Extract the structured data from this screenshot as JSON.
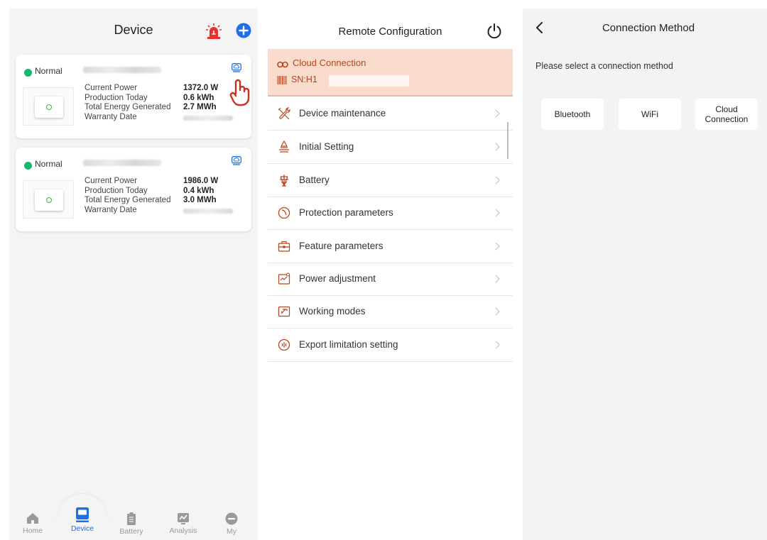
{
  "device_screen": {
    "title": "Device",
    "cards": [
      {
        "status": "Normal",
        "labels": [
          "Current Power",
          "Production Today",
          "Total Energy Generated",
          "Warranty Date"
        ],
        "current_power": "1372.0 W",
        "production_today": "0.6 kWh",
        "total_energy": "2.7 MWh"
      },
      {
        "status": "Normal",
        "labels": [
          "Current Power",
          "Production Today",
          "Total Energy Generated",
          "Warranty Date"
        ],
        "current_power": "1986.0 W",
        "production_today": "0.4 kWh",
        "total_energy": "3.0 MWh"
      }
    ],
    "tabs": [
      {
        "label": "Home",
        "icon": "home-icon"
      },
      {
        "label": "Device",
        "icon": "device-icon"
      },
      {
        "label": "Battery",
        "icon": "battery-icon"
      },
      {
        "label": "Analysis",
        "icon": "analysis-icon"
      },
      {
        "label": "My",
        "icon": "user-icon"
      }
    ],
    "active_tab": "Device"
  },
  "remote_config": {
    "title": "Remote Configuration",
    "connection_label": "Cloud Connection",
    "sn_label": "SN:H1",
    "menu": [
      {
        "label": "Device maintenance",
        "icon": "tools-icon"
      },
      {
        "label": "Initial Setting",
        "icon": "initial-setting-icon"
      },
      {
        "label": "Battery",
        "icon": "battery-tower-icon"
      },
      {
        "label": "Protection parameters",
        "icon": "protection-icon"
      },
      {
        "label": "Feature parameters",
        "icon": "toolbox-icon"
      },
      {
        "label": "Power adjustment",
        "icon": "power-adjust-icon"
      },
      {
        "label": "Working modes",
        "icon": "working-mode-icon"
      },
      {
        "label": "Export limitation setting",
        "icon": "gauge-icon"
      }
    ]
  },
  "connection_method": {
    "title": "Connection Method",
    "prompt": "Please select a connection method",
    "options": [
      "Bluetooth",
      "WiFi",
      "Cloud\nConnection"
    ]
  },
  "colors": {
    "accent_blue": "#1f6fe5",
    "status_green": "#14b86e",
    "alert_red": "#e5322d",
    "banner_bg": "#f9dccb",
    "banner_text": "#b8431e"
  }
}
